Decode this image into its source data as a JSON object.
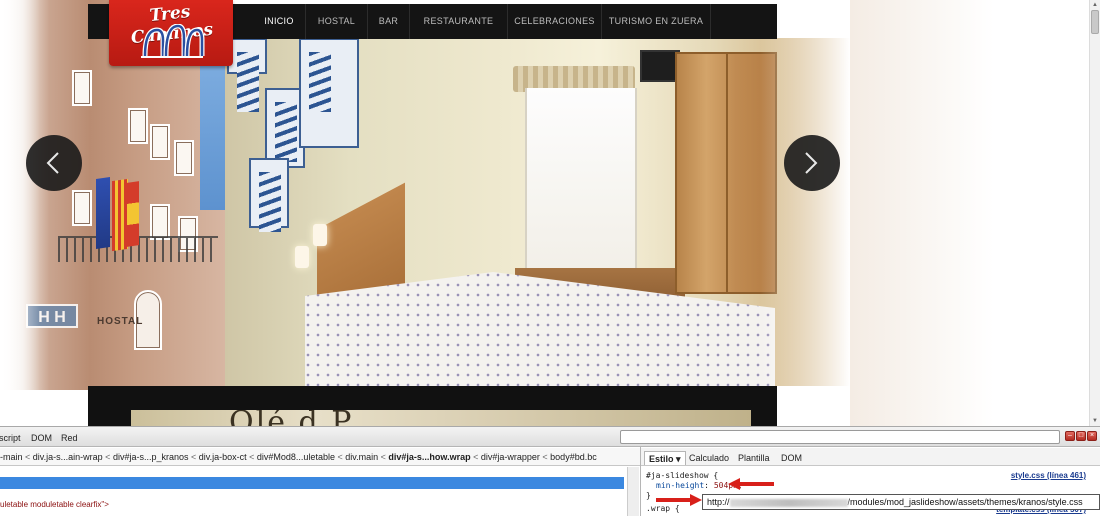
{
  "website": {
    "logo_text": "Tres Caminos",
    "nav": [
      {
        "label": "INICIO",
        "active": true
      },
      {
        "label": "HOSTAL",
        "active": false
      },
      {
        "label": "BAR",
        "active": false
      },
      {
        "label": "RESTAURANTE",
        "active": false
      },
      {
        "label": "CELEBRACIONES",
        "active": false
      },
      {
        "label": "TURISMO EN ZUERA",
        "active": false
      }
    ],
    "photo_sign_text": "HOSTAL",
    "photo_sign_letters": "H H",
    "content_heading_partial": "Olé d P   ",
    "slide_prev_icon": "chevron-left-icon",
    "slide_next_icon": "chevron-right-icon"
  },
  "firebug": {
    "tabs": [
      "Script",
      "DOM",
      "Red"
    ],
    "tab_display": [
      "script",
      "DOM",
      "Red"
    ],
    "search_icon": "search-icon",
    "window_buttons": [
      "minimize-icon",
      "restore-icon",
      "close-icon"
    ],
    "breadcrumbs": [
      {
        "label": "-main",
        "bold": false
      },
      {
        "label": "div.ja-s...ain-wrap",
        "bold": false
      },
      {
        "label": "div#ja-s...p_kranos",
        "bold": false
      },
      {
        "label": "div.ja-box-ct",
        "bold": false
      },
      {
        "label": "div#Mod8...uletable",
        "bold": false
      },
      {
        "label": "div.main",
        "bold": false
      },
      {
        "label": "div#ja-s...how.wrap",
        "bold": true
      },
      {
        "label": "div#ja-wrapper",
        "bold": false
      },
      {
        "label": "body#bd.bc",
        "bold": false
      }
    ],
    "html_node_text": "uletable moduletable clearfix\">",
    "side_tabs": [
      {
        "label": "Estilo ▾",
        "active": true
      },
      {
        "label": "Calculado",
        "active": false
      },
      {
        "label": "Plantilla",
        "active": false
      },
      {
        "label": "DOM",
        "active": false
      }
    ],
    "css": {
      "selector": "#ja-slideshow {",
      "property": "min-height",
      "value": "504px;",
      "close_brace": "}",
      "next_selector": ".wrap {",
      "source_link": "style.css (línea 461)",
      "next_source_link": "template.css (línea 507)"
    },
    "tooltip": {
      "prefix": "http://",
      "suffix": "/modules/mod_jaslideshow/assets/themes/kranos/style.css"
    }
  },
  "colors": {
    "navbar_bg": "#141414",
    "logo_red": "#c81f17",
    "selection_blue": "#3b88e0",
    "annotation_red": "#d8201a"
  }
}
